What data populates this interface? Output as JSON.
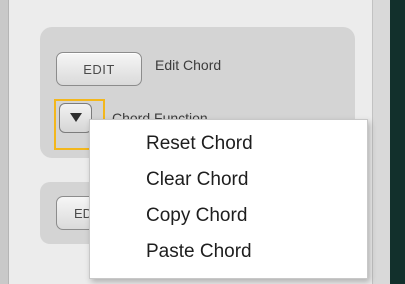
{
  "chord_panel": {
    "edit_button_label": "EDIT",
    "edit_label": "Edit Chord",
    "function_label": "Chord Function",
    "function_button_icon": "triangle-down-icon",
    "second_button_label": "EDIT"
  },
  "context_menu": {
    "items": [
      {
        "label": "Reset Chord"
      },
      {
        "label": "Clear Chord"
      },
      {
        "label": "Copy Chord"
      },
      {
        "label": "Paste Chord"
      }
    ]
  },
  "colors": {
    "focus_highlight": "#f3b71c",
    "panel": "#d4d4d4",
    "right_dark_strip": "#12302c"
  }
}
